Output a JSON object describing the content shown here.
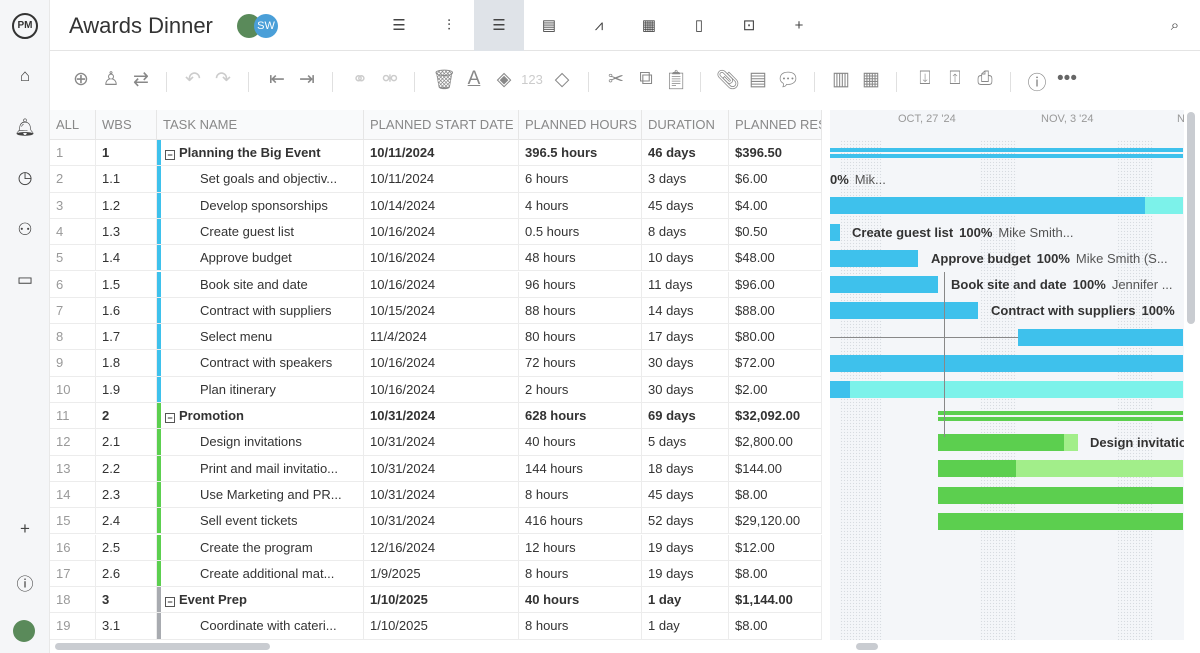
{
  "app": {
    "logo": "PM",
    "title": "Awards Dinner",
    "avatars": [
      {
        "initials": "",
        "color": "#5a8a5a"
      },
      {
        "initials": "SW",
        "color": "#4a9fd8"
      }
    ]
  },
  "nav": [
    "home-icon",
    "bell-icon",
    "clock-icon",
    "users-icon",
    "briefcase-icon",
    "plus-icon",
    "help-icon",
    "user-avatar"
  ],
  "views": [
    {
      "name": "list-view",
      "glyph": "☰"
    },
    {
      "name": "board-view",
      "glyph": "⫶"
    },
    {
      "name": "gantt-view",
      "glyph": "☰",
      "active": true
    },
    {
      "name": "sheet-view",
      "glyph": "▤"
    },
    {
      "name": "dashboard-view",
      "glyph": "⩘"
    },
    {
      "name": "calendar-view",
      "glyph": "▦"
    },
    {
      "name": "files-view",
      "glyph": "▯"
    },
    {
      "name": "issues-view",
      "glyph": "⊡"
    },
    {
      "name": "add-view",
      "glyph": "+"
    }
  ],
  "toolbar": {
    "number_label": "123"
  },
  "columns": [
    "ALL",
    "WBS",
    "TASK NAME",
    "PLANNED START DATE",
    "PLANNED HOURS",
    "DURATION",
    "PLANNED RES"
  ],
  "rows": [
    {
      "n": "1",
      "wbs": "1",
      "name": "Planning the Big Event",
      "start": "10/11/2024",
      "hours": "396.5 hours",
      "dur": "46 days",
      "res": "$396.50",
      "group": true,
      "color": "#3ec1ec"
    },
    {
      "n": "2",
      "wbs": "1.1",
      "name": "Set goals and objectiv...",
      "start": "10/11/2024",
      "hours": "6 hours",
      "dur": "3 days",
      "res": "$6.00",
      "color": "#3ec1ec"
    },
    {
      "n": "3",
      "wbs": "1.2",
      "name": "Develop sponsorships",
      "start": "10/14/2024",
      "hours": "4 hours",
      "dur": "45 days",
      "res": "$4.00",
      "color": "#3ec1ec"
    },
    {
      "n": "4",
      "wbs": "1.3",
      "name": "Create guest list",
      "start": "10/16/2024",
      "hours": "0.5 hours",
      "dur": "8 days",
      "res": "$0.50",
      "color": "#3ec1ec"
    },
    {
      "n": "5",
      "wbs": "1.4",
      "name": "Approve budget",
      "start": "10/16/2024",
      "hours": "48 hours",
      "dur": "10 days",
      "res": "$48.00",
      "color": "#3ec1ec"
    },
    {
      "n": "6",
      "wbs": "1.5",
      "name": "Book site and date",
      "start": "10/16/2024",
      "hours": "96 hours",
      "dur": "11 days",
      "res": "$96.00",
      "color": "#3ec1ec"
    },
    {
      "n": "7",
      "wbs": "1.6",
      "name": "Contract with suppliers",
      "start": "10/15/2024",
      "hours": "88 hours",
      "dur": "14 days",
      "res": "$88.00",
      "color": "#3ec1ec"
    },
    {
      "n": "8",
      "wbs": "1.7",
      "name": "Select menu",
      "start": "11/4/2024",
      "hours": "80 hours",
      "dur": "17 days",
      "res": "$80.00",
      "color": "#3ec1ec"
    },
    {
      "n": "9",
      "wbs": "1.8",
      "name": "Contract with speakers",
      "start": "10/16/2024",
      "hours": "72 hours",
      "dur": "30 days",
      "res": "$72.00",
      "color": "#3ec1ec"
    },
    {
      "n": "10",
      "wbs": "1.9",
      "name": "Plan itinerary",
      "start": "10/16/2024",
      "hours": "2 hours",
      "dur": "30 days",
      "res": "$2.00",
      "color": "#3ec1ec"
    },
    {
      "n": "11",
      "wbs": "2",
      "name": "Promotion",
      "start": "10/31/2024",
      "hours": "628 hours",
      "dur": "69 days",
      "res": "$32,092.00",
      "group": true,
      "color": "#5ccf4f"
    },
    {
      "n": "12",
      "wbs": "2.1",
      "name": "Design invitations",
      "start": "10/31/2024",
      "hours": "40 hours",
      "dur": "5 days",
      "res": "$2,800.00",
      "color": "#5ccf4f"
    },
    {
      "n": "13",
      "wbs": "2.2",
      "name": "Print and mail invitatio...",
      "start": "10/31/2024",
      "hours": "144 hours",
      "dur": "18 days",
      "res": "$144.00",
      "color": "#5ccf4f"
    },
    {
      "n": "14",
      "wbs": "2.3",
      "name": "Use Marketing and PR...",
      "start": "10/31/2024",
      "hours": "8 hours",
      "dur": "45 days",
      "res": "$8.00",
      "color": "#5ccf4f"
    },
    {
      "n": "15",
      "wbs": "2.4",
      "name": "Sell event tickets",
      "start": "10/31/2024",
      "hours": "416 hours",
      "dur": "52 days",
      "res": "$29,120.00",
      "color": "#5ccf4f"
    },
    {
      "n": "16",
      "wbs": "2.5",
      "name": "Create the program",
      "start": "12/16/2024",
      "hours": "12 hours",
      "dur": "19 days",
      "res": "$12.00",
      "color": "#5ccf4f"
    },
    {
      "n": "17",
      "wbs": "2.6",
      "name": "Create additional mat...",
      "start": "1/9/2025",
      "hours": "8 hours",
      "dur": "19 days",
      "res": "$8.00",
      "color": "#5ccf4f"
    },
    {
      "n": "18",
      "wbs": "3",
      "name": "Event Prep",
      "start": "1/10/2025",
      "hours": "40 hours",
      "dur": "1 day",
      "res": "$1,144.00",
      "group": true,
      "color": "#a8abb0"
    },
    {
      "n": "19",
      "wbs": "3.1",
      "name": "Coordinate with cateri...",
      "start": "1/10/2025",
      "hours": "8 hours",
      "dur": "1 day",
      "res": "$8.00",
      "color": "#a8abb0"
    }
  ],
  "gantt": {
    "weeks": [
      "OCT, 27 '24",
      "NOV, 3 '24",
      "N"
    ],
    "labels": [
      {
        "row": 2,
        "name": "",
        "pct": "0%",
        "who": "Mik..."
      },
      {
        "row": 4,
        "name": "Create guest list",
        "pct": "100%",
        "who": "Mike Smith..."
      },
      {
        "row": 5,
        "name": "Approve budget",
        "pct": "100%",
        "who": "Mike Smith (S..."
      },
      {
        "row": 6,
        "name": "Book site and date",
        "pct": "100%",
        "who": "Jennifer ..."
      },
      {
        "row": 7,
        "name": "Contract with suppliers",
        "pct": "100%",
        "who": ""
      },
      {
        "row": 12,
        "name": "Design invitatio",
        "pct": "",
        "who": ""
      }
    ],
    "colors": {
      "blue": "#3ec1ec",
      "cyan": "#7cf2ea",
      "green": "#5ccf4f",
      "lightgreen": "#a2ee8a"
    }
  }
}
